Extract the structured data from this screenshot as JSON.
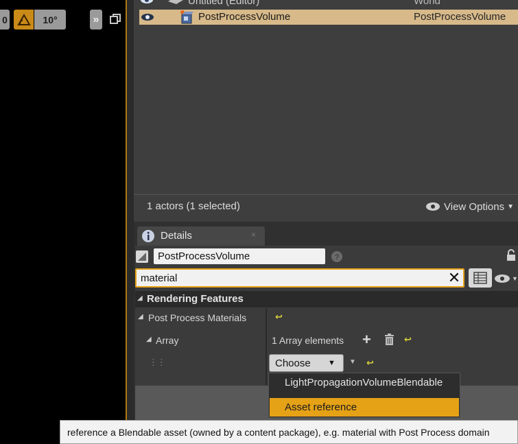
{
  "viewport": {
    "partial_value": "0",
    "snap_angle": "10°",
    "more_glyph": "»"
  },
  "outliner": {
    "rows": [
      {
        "label": "Untitled (Editor)",
        "type": "World"
      },
      {
        "label": "PostProcessVolume",
        "type": "PostProcessVolume"
      }
    ],
    "status": "1 actors (1 selected)",
    "view_options": "View Options"
  },
  "details": {
    "tab_label": "Details",
    "name_value": "PostProcessVolume",
    "search_value": "material",
    "section": "Rendering Features",
    "prop_post_process_materials": "Post Process Materials",
    "prop_array": "Array",
    "array_count": "1 Array elements",
    "choose_label": "Choose"
  },
  "dropdown": {
    "items": [
      "LightPropagationVolumeBlendable",
      "Asset reference"
    ]
  },
  "tooltip": "reference a Blendable asset (owned by a content package), e.g. material with Post Process domain",
  "colors": {
    "selection": "#d7b98a",
    "accent": "#e5a217",
    "reset": "#d6cf3a"
  }
}
